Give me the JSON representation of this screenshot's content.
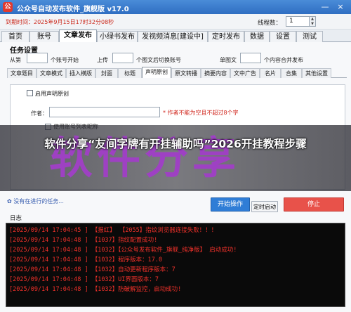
{
  "window": {
    "title": "公众号自动发布软件_旗舰版   v17.0",
    "icon_label": "公",
    "minimize_symbol": "—",
    "close_symbol": "×"
  },
  "info": {
    "expiry": "到期时间：2025年9月15日17时32分08秒",
    "threads_label": "线程数：",
    "threads_value": "1"
  },
  "main_tabs": [
    "首页",
    "账号",
    "文章发布",
    "小绿书发布",
    "发视频消息[建设中]",
    "定时发布",
    "数据",
    "设置",
    "测试"
  ],
  "main_tab_active": "文章发布",
  "task_settings": {
    "title": "任务设置",
    "start_label": "从第",
    "start_suffix": "个账号开始",
    "upload_label": "上传",
    "upload_suffix": "个图文后切换账号",
    "single_label": "单图文",
    "single_suffix": "个内容合并发布"
  },
  "sub_tabs": [
    "文章题目",
    "文章模式",
    "插入横版",
    "封面",
    "标题",
    "声明原创",
    "原文转播",
    "摘要内容",
    "文中广告",
    "名片",
    "合集",
    "其他设置"
  ],
  "sub_tab_active": "声明原创",
  "original": {
    "enable_label": "启用声明原创",
    "author_label": "作者：",
    "author_hint": "* 作者不能为空且不超过8个字",
    "use_account_label": "使用账号列表昵称"
  },
  "overlay": {
    "big_text": "软件分享",
    "headline": "软件分享“友间字牌有开挂辅助吗”2026开挂教程步骤"
  },
  "status": {
    "text": "✿ 没有在进行的任务..."
  },
  "buttons": {
    "start": "开始操作",
    "timer": "定时启动",
    "stop": "停止"
  },
  "log": {
    "title": "日志",
    "lines": [
      "[2025/09/14 17:04:45 ] 【报红】 【2055】指纹浏览器连接失败！！！",
      "[2025/09/14 17:04:48 ] 【1037】指纹配置成功!",
      "[2025/09/14 17:04:48 ] 【1032】【公众号发布软件_旗舰_纯净版】 启动成功!",
      "[2025/09/14 17:04:48 ] 【1032】程序版本：17.0",
      "[2025/09/14 17:04:48 ] 【1032】自动更新程序版本：7",
      "[2025/09/14 17:04:48 ] 【1032】UI界面版本：7",
      "[2025/09/14 17:04:48 ] 【1032】防破解监控，启动成功!"
    ]
  },
  "colors": {
    "title_bar": "#2f6ec2",
    "start_button": "#2f7dd6",
    "stop_button": "#e8524a",
    "log_text": "#f0312a",
    "watermark": "#a13fc7"
  }
}
